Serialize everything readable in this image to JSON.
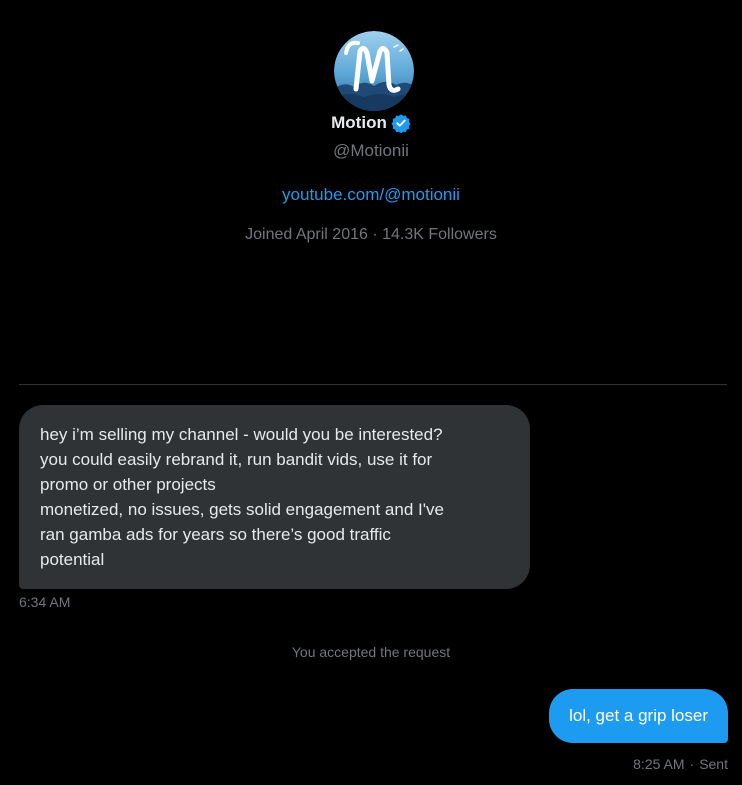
{
  "profile": {
    "display_name": "Motion",
    "handle": "@Motionii",
    "link": "youtube.com/@motionii",
    "meta": "Joined April 2016 · 14.3K Followers"
  },
  "icons": {
    "avatar": "profile-avatar-m-logo",
    "verified": "verified-badge-icon"
  },
  "colors": {
    "background": "#000000",
    "accent": "#1d9bf0",
    "incoming_bubble": "#2f3336",
    "muted_text": "#71767b"
  },
  "conversation": {
    "incoming": {
      "lines": [
        "hey i’m selling my channel - would you be interested?",
        "you could easily rebrand it, run bandit vids, use it for",
        "promo or other projects",
        "monetized, no issues, gets solid engagement and I've",
        "ran gamba ads for years so there’s good traffic",
        "potential"
      ],
      "time": "6:34 AM"
    },
    "system_note": "You accepted the request",
    "outgoing": {
      "text": "lol, get a grip loser",
      "time": "8:25 AM",
      "separator": "·",
      "status": "Sent"
    }
  }
}
